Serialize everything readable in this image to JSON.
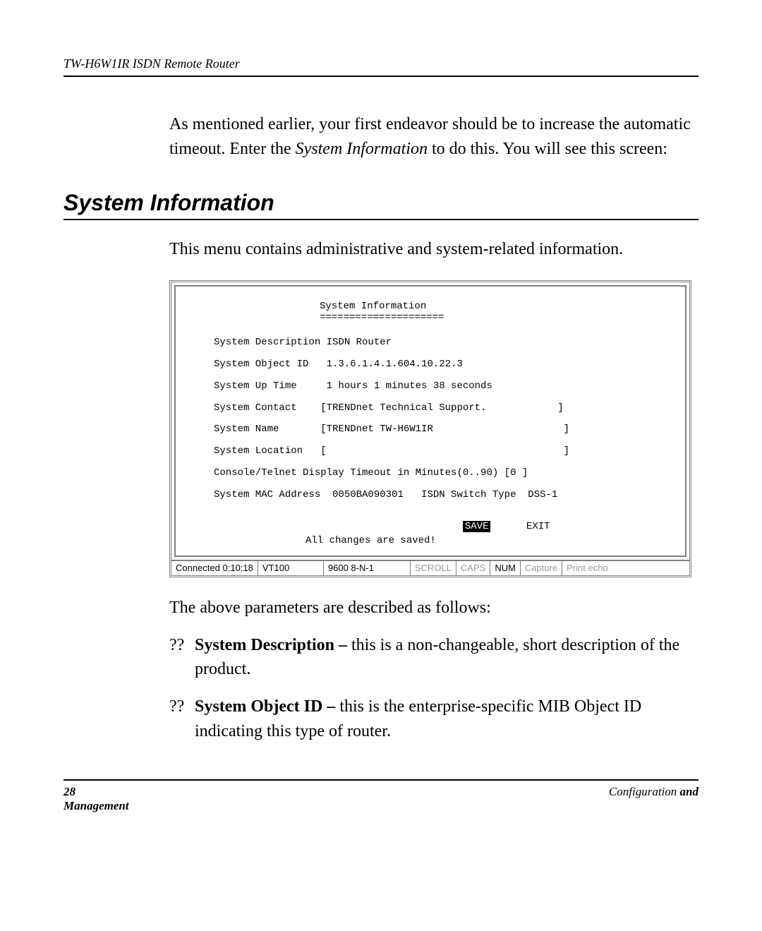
{
  "running_head": "TW-H6W1IR ISDN Remote Router",
  "intro_part1": "As mentioned earlier, your first endeavor should be to increase the automatic timeout.  Enter the ",
  "intro_italic": "System Information",
  "intro_part2": " to do this.  You will see this screen:",
  "section_title": "System Information",
  "after_title": "This menu contains administrative and system-related information.",
  "terminal": {
    "title": "System Information",
    "underline": "=====================",
    "rows": {
      "r1": "System Description ISDN Router",
      "r2": "System Object ID   1.3.6.1.4.1.604.10.22.3",
      "r3": "System Up Time     1 hours 1 minutes 38 seconds",
      "r4": "System Contact    [TRENDnet Technical Support.            ]",
      "r5": "System Name       [TRENDnet TW-H6W1IR                      ]",
      "r6": "System Location   [                                        ]",
      "r7": "Console/Telnet Display Timeout in Minutes(0..90) [0 ]",
      "r8": "System MAC Address  0050BA090301   ISDN Switch Type  DSS-1"
    },
    "save": "SAVE",
    "exit": "EXIT",
    "saved_msg": "All changes are saved!",
    "status": {
      "connected": "Connected 0:10:18",
      "term": "VT100",
      "baud": "9600 8-N-1",
      "scroll": "SCROLL",
      "caps": "CAPS",
      "num": "NUM",
      "capture": "Capture",
      "printecho": "Print echo"
    }
  },
  "para_after": "The above parameters are described as follows:",
  "bullet_mark": "??",
  "bullet1_bold": "System Description – ",
  "bullet1_rest": "this is a non-changeable, short description of the product.",
  "bullet2_bold": "System Object ID – ",
  "bullet2_rest": "this is the enterprise-specific MIB Object ID indicating this type of router.",
  "footer": {
    "pagenum": "28",
    "right_italic": "Configuration ",
    "right_bold": "and",
    "line2": "Management"
  }
}
